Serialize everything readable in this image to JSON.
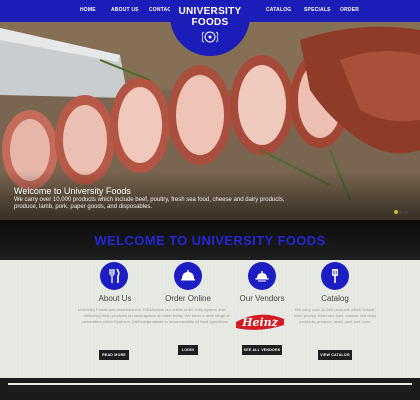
{
  "nav": {
    "items_left": [
      "HOME",
      "ABOUT US",
      "CONTACT US"
    ],
    "items_right": [
      "CATALOG",
      "SPECIALS",
      "ORDER"
    ]
  },
  "logo": {
    "line1": "UNIVERSITY",
    "line2": "FOODS"
  },
  "hero": {
    "title": "Welcome to University Foods",
    "text": "We carry over 10,000 products which include beef, poultry, fresh sea food, cheese and dairy products, produce, lamb, pork, paper goods, and disposables.",
    "active_slide": 1,
    "slide_count": 3
  },
  "section": {
    "title": "WELCOME TO UNIVERSITY FOODS"
  },
  "columns": [
    {
      "icon": "utensils-icon",
      "title": "About Us",
      "text": "University Foods was established in 1984, delivering fresh products on various universities within Southern California",
      "button": "READ MORE"
    },
    {
      "icon": "cloche-icon",
      "title": "Order Online",
      "text": "Access our online order entry system and place an order today. We stock a wide range of products to accommodate all food operations",
      "button": "LOGIN"
    },
    {
      "icon": "serving-tray-icon",
      "title": "Our Vendors",
      "text": "",
      "vendor_logo": "Heinz",
      "button": "SEE ALL VENDORS"
    },
    {
      "icon": "spatula-icon",
      "title": "Catalog",
      "text": "We carry over 10,000 products which include beef, poultry, fresh sea food, cheese and dairy products, produce, lamb, pork and more",
      "button": "VIEW CATALOG"
    }
  ],
  "colors": {
    "brand_blue": "#1c1cb8",
    "title_blue": "#2525d8",
    "slider_active": "#c6c318"
  }
}
